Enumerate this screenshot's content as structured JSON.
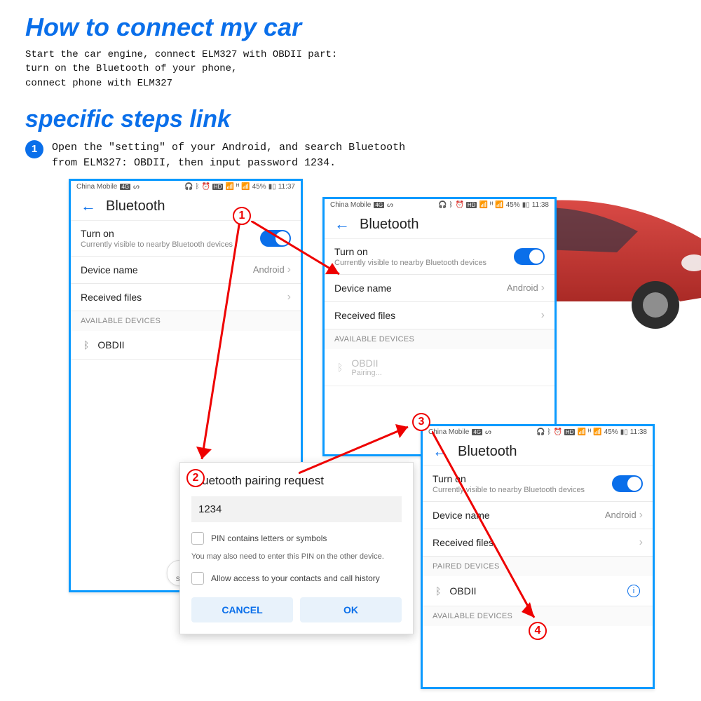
{
  "heading": "How to connect my car",
  "description": "Start the car engine, connect ELM327 with OBDII part:\nturn on the Bluetooth of your phone,\nconnect phone with ELM327",
  "heading2": "specific steps link",
  "step1_num": "1",
  "step1_text": "Open the \"setting\" of your Android, and search Bluetooth\nfrom ELM327: OBDII, then input password 1234.",
  "statusbar": {
    "carrier": "China Mobile",
    "carrier_badge": "4G",
    "swirl": "ᔕ",
    "battery": "45%",
    "time1": "11:37",
    "time2": "11:38",
    "hd": "HD"
  },
  "bt": {
    "title": "Bluetooth",
    "turnon": "Turn on",
    "turnon_sub": "Currently visible to nearby Bluetooth devices",
    "devname_label": "Device name",
    "devname_value": "Android",
    "received": "Received files",
    "available": "AVAILABLE DEVICES",
    "paired": "PAIRED DEVICES",
    "obdii": "OBDII",
    "pairing": "Pairing...",
    "search": "Search"
  },
  "dialog": {
    "title": "Bluetooth pairing request",
    "pin": "1234",
    "chk1": "PIN contains letters or symbols",
    "note": "You may also need to enter this PIN on the other device.",
    "chk2": "Allow access to your contacts and call history",
    "cancel": "CANCEL",
    "ok": "OK"
  },
  "callouts": {
    "c1": "1",
    "c2": "2",
    "c3": "3",
    "c4": "4"
  }
}
